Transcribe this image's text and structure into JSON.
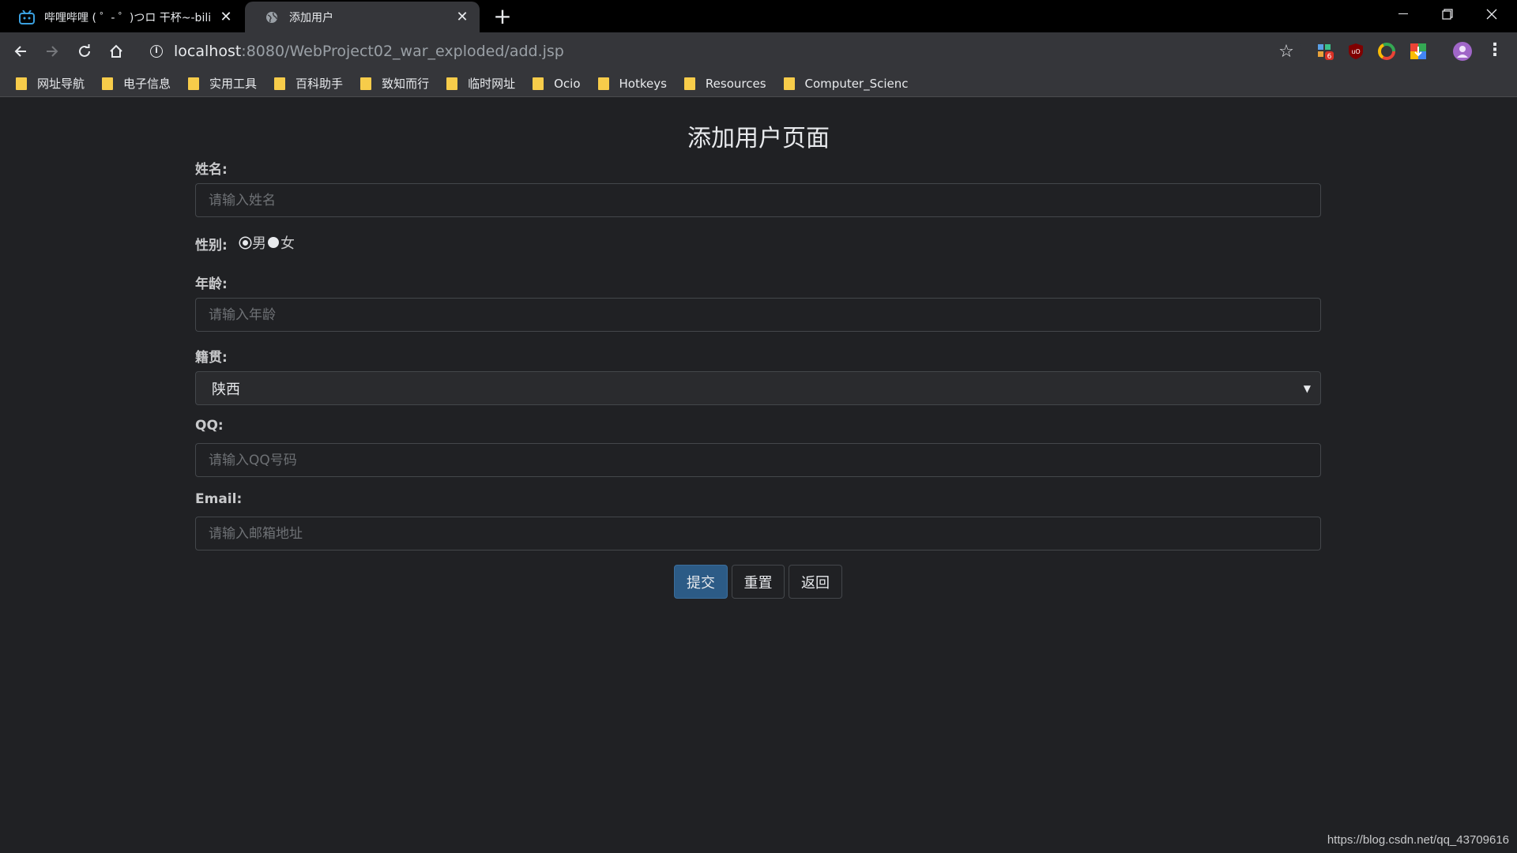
{
  "tabs": [
    {
      "title": "哔哩哔哩 ( ゜- ゜)つロ 干杯~-bili",
      "active": false
    },
    {
      "title": "添加用户",
      "active": true
    }
  ],
  "toolbar": {
    "url_host": "localhost",
    "url_rest": ":8080/WebProject02_war_exploded/add.jsp",
    "ext_badge": "6"
  },
  "bookmarks": [
    {
      "label": "网址导航"
    },
    {
      "label": "电子信息"
    },
    {
      "label": "实用工具"
    },
    {
      "label": "百科助手"
    },
    {
      "label": "致知而行"
    },
    {
      "label": "临时网址"
    },
    {
      "label": "Ocio"
    },
    {
      "label": "Hotkeys"
    },
    {
      "label": "Resources"
    },
    {
      "label": "Computer_Scienc"
    }
  ],
  "form": {
    "heading": "添加用户页面",
    "name_label": "姓名:",
    "name_placeholder": "请输入姓名",
    "gender_label": "性别:",
    "gender_male": "男",
    "gender_female": "女",
    "age_label": "年龄:",
    "age_placeholder": "请输入年龄",
    "origin_label": "籍贯:",
    "origin_value": "陕西",
    "qq_label": "QQ:",
    "qq_placeholder": "请输入QQ号码",
    "email_label": "Email:",
    "email_placeholder": "请输入邮箱地址",
    "submit_label": "提交",
    "reset_label": "重置",
    "back_label": "返回"
  },
  "footer_url": "https://blog.csdn.net/qq_43709616",
  "colors": {
    "primary_button": "#2c5b86",
    "page_background": "#202124",
    "folder": "#f7cc4a"
  }
}
